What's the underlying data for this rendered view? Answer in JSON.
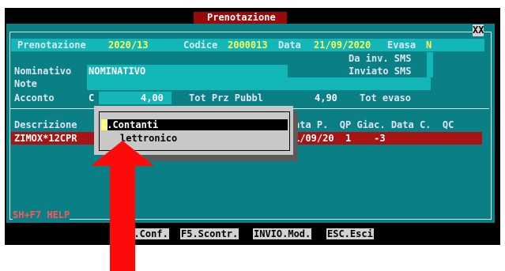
{
  "title": "Prenotazione",
  "close": "XX",
  "header": {
    "label": "Prenotazione",
    "number": "2020/13",
    "codice_label": "Codice",
    "codice": "2000013",
    "data_label": "Data",
    "data": "21/09/2020",
    "evasa_label": "Evasa",
    "evasa": "N"
  },
  "sms": {
    "da_inv": "Da inv. SMS",
    "inviato": "Inviato SMS"
  },
  "fields": {
    "nominativo_label": "Nominativo",
    "nominativo": "NOMINATIVO",
    "note_label": "Note",
    "acconto_label": "Acconto",
    "acconto_code": "C",
    "acconto_value": "4,00",
    "tot_prz_label": "Tot Prz Pubbl",
    "tot_prz": "4,90",
    "tot_evaso_label": "Tot evaso"
  },
  "table": {
    "header_left": "Descrizione",
    "header_right": "ata P.  QP Giac. Data C.  QC",
    "row_left": "ZIMOX*12CPR",
    "row_right": "1/09/20  1    -3"
  },
  "dropdown": {
    "options": [
      "C.Contanti",
      "E.Elettronico"
    ],
    "selected": 0,
    "option2_visible": "lettronico"
  },
  "help": "SH+F7 HELP",
  "footer_buttons": [
    "F1.Conf.",
    "F5.Scontr.",
    "INVIO.Mod.",
    "ESC.Esci"
  ]
}
